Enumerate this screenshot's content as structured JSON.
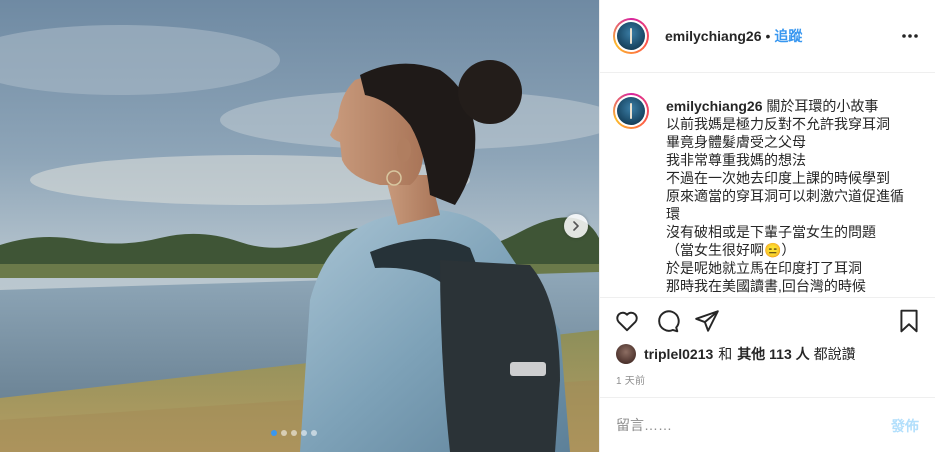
{
  "header": {
    "username": "emilychiang26",
    "separator": "•",
    "follow_label": "追蹤"
  },
  "caption": {
    "username": "emilychiang26",
    "lines": [
      "關於耳環的小故事",
      "以前我媽是極力反對不允許我穿耳洞",
      "畢竟身體髮膚受之父母",
      "我非常尊重我媽的想法",
      "不過在一次她去印度上課的時候學到",
      "原來適當的穿耳洞可以刺激穴道促進循",
      "環",
      "沒有破相或是下輩子當女生的問題",
      "（當女生很好啊😑）",
      "於是呢她就立馬在印度打了耳洞",
      "那時我在美國讀書,回台灣的時候"
    ]
  },
  "likes": {
    "user": "triplel0213",
    "connector": "和",
    "others": "其他 113 人",
    "suffix": "都說讚"
  },
  "timestamp": "1 天前",
  "comment": {
    "placeholder": "留言……",
    "post_label": "發佈"
  },
  "carousel": {
    "count": 5,
    "active_index": 0
  },
  "icons": {
    "more": "more-options-icon",
    "like": "heart-icon",
    "comment": "comment-icon",
    "share": "share-icon",
    "save": "bookmark-icon",
    "next": "chevron-right-icon"
  },
  "colors": {
    "link": "#3897f0",
    "post_disabled": "#b2dffc",
    "muted": "#8e8e8e"
  }
}
